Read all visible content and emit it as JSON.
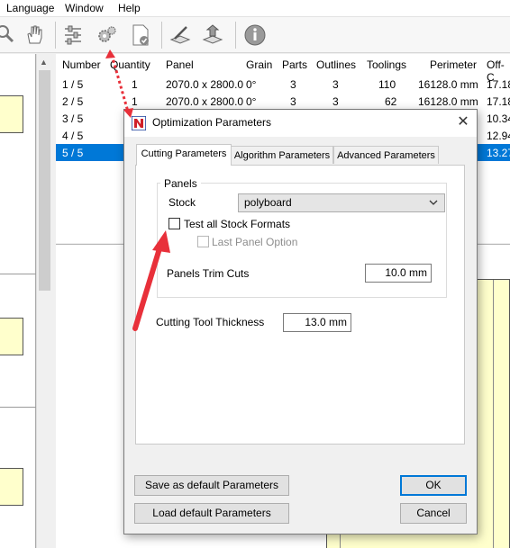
{
  "menubar": {
    "items": [
      "Language",
      "Window",
      "Help"
    ]
  },
  "toolbar": {
    "icons": [
      "zoom-icon",
      "hand-pan-icon",
      "cut-settings-icon",
      "gears-icon",
      "document-check-icon",
      "edit-panel-icon",
      "export-icon",
      "info-icon"
    ]
  },
  "table": {
    "headers": [
      "Number",
      "Quantity",
      "Panel",
      "Grain",
      "Parts",
      "Outlines",
      "Toolings",
      "Perimeter",
      "Off-C"
    ],
    "rows": [
      [
        "1 / 5",
        "1",
        "2070.0 x 2800.0",
        "0°",
        "3",
        "3",
        "110",
        "16128.0 mm",
        "17.18"
      ],
      [
        "2 / 5",
        "1",
        "2070.0 x 2800.0",
        "0°",
        "3",
        "3",
        "62",
        "16128.0 mm",
        "17.18"
      ],
      [
        "3 / 5",
        "",
        "",
        "",
        "",
        "",
        "",
        "",
        "10.34"
      ],
      [
        "4 / 5",
        "",
        "",
        "",
        "",
        "",
        "",
        "",
        "12.94"
      ],
      [
        "5 / 5",
        "",
        "",
        "",
        "",
        "",
        "",
        "",
        "13.27"
      ]
    ]
  },
  "dialog": {
    "title": "Optimization Parameters",
    "close_glyph": "✕",
    "tabs": [
      "Cutting Parameters",
      "Algorithm Parameters",
      "Advanced Parameters"
    ],
    "panels_group_label": "Panels",
    "stock_label": "Stock",
    "stock_value": "polyboard",
    "test_all_label": "Test all Stock Formats",
    "test_all_checked": false,
    "last_panel_label": "Last Panel Option",
    "last_panel_checked": false,
    "trim_cuts_label": "Panels Trim Cuts",
    "trim_cuts_value": "10.0 mm",
    "tool_thickness_label": "Cutting Tool Thickness",
    "tool_thickness_value": "13.0 mm",
    "save_default_label": "Save as default Parameters",
    "load_default_label": "Load default Parameters",
    "ok_label": "OK",
    "cancel_label": "Cancel"
  },
  "colors": {
    "selection": "#0078d7",
    "panel_fill": "#ffffcc",
    "annotation_arrow": "#e8303a",
    "app_icon_red": "#d0202a",
    "app_icon_blue": "#1a3f9c"
  }
}
